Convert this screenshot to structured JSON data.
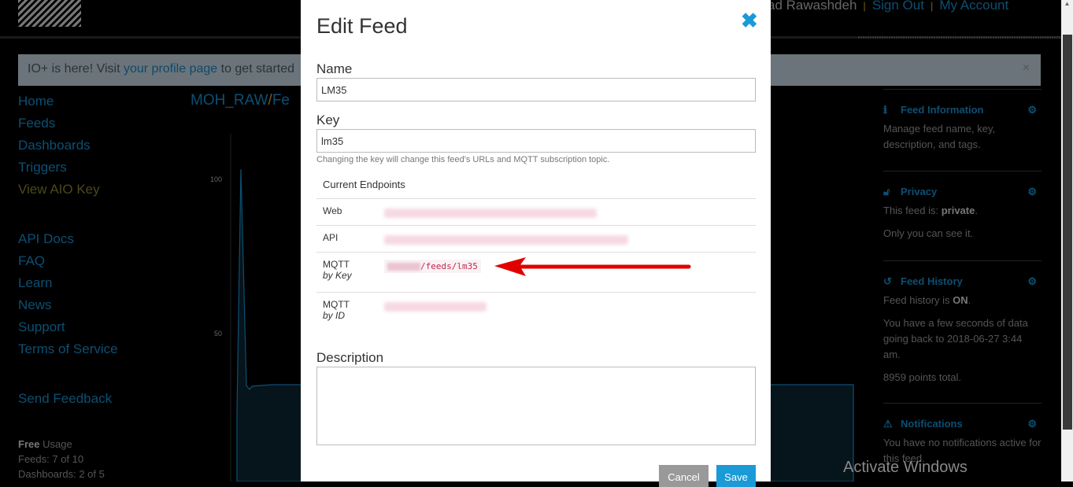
{
  "header": {
    "user": "ad Rawashdeh",
    "sign_out": "Sign Out",
    "my_account": "My Account"
  },
  "notice": {
    "prefix": "IO+ is here! Visit ",
    "link": "your profile page",
    "suffix": " to get started",
    "close": "×"
  },
  "sidebar": {
    "items": [
      {
        "label": "Home"
      },
      {
        "label": "Feeds"
      },
      {
        "label": "Dashboards"
      },
      {
        "label": "Triggers"
      },
      {
        "label": "View AIO Key"
      },
      {
        "label": "API Docs"
      },
      {
        "label": "FAQ"
      },
      {
        "label": "Learn"
      },
      {
        "label": "News"
      },
      {
        "label": "Support"
      },
      {
        "label": "Terms of Service"
      },
      {
        "label": "Send Feedback"
      }
    ],
    "usage": {
      "plan": "Free",
      "usage_label": "Usage",
      "feeds": "Feeds: 7 of 10",
      "dashboards": "Dashboards: 2 of 5"
    }
  },
  "breadcrumb": {
    "user": "MOH_RAW",
    "sep": "/",
    "feed": "Fe"
  },
  "chart": {
    "ticks": [
      "100",
      "50"
    ]
  },
  "right_panel": {
    "feed_info": {
      "title": "Feed Information",
      "text": "Manage feed name, key, description, and tags."
    },
    "privacy": {
      "title": "Privacy",
      "text_prefix": "This feed is: ",
      "value": "private",
      "text2": "Only you can see it."
    },
    "history": {
      "title": "Feed History",
      "text_prefix": "Feed history is ",
      "value": "ON",
      "text2": "You have a few seconds of data going back to 2018-06-27 3:44 am.",
      "points": "8959 points total."
    },
    "notifications": {
      "title": "Notifications",
      "text": "You have no notifications active for this feed."
    }
  },
  "modal": {
    "title": "Edit Feed",
    "close": "✖",
    "name_label": "Name",
    "name_value": "LM35",
    "key_label": "Key",
    "key_value": "lm35",
    "key_help": "Changing the key will change this feed's URLs and MQTT subscription topic.",
    "endpoints_title": "Current Endpoints",
    "endpoints": [
      {
        "label": "Web",
        "sub": ""
      },
      {
        "label": "API",
        "sub": ""
      },
      {
        "label": "MQTT",
        "sub": "by Key",
        "value": "/feeds/lm35"
      },
      {
        "label": "MQTT",
        "sub": "by ID"
      }
    ],
    "description_label": "Description",
    "description_value": "",
    "cancel": "Cancel",
    "save": "Save"
  },
  "watermark": "Activate Windows",
  "colors": {
    "accent": "#1a9ad6",
    "arrow": "#e00000",
    "code": "#c7254e"
  }
}
